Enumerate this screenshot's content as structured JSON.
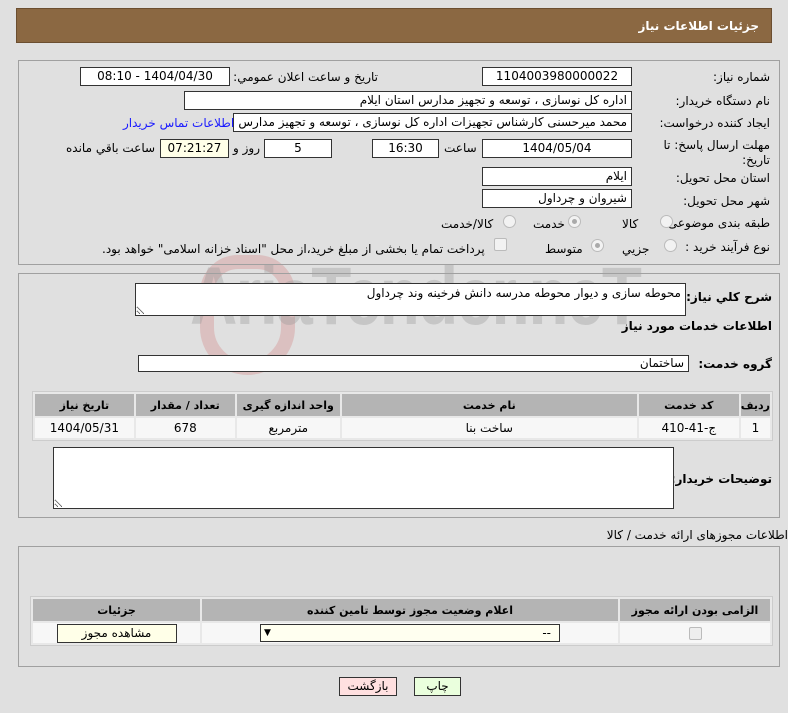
{
  "header": {
    "title": "جزئیات اطلاعات نیاز"
  },
  "details": {
    "need_number_label": "شماره نیاز:",
    "need_number": "1104003980000022",
    "announce_label": "تاریخ و ساعت اعلان عمومي:",
    "announce_value": "1404/04/30 - 08:10",
    "buyer_org_label": "نام دستگاه خریدار:",
    "buyer_org": "اداره کل نوسازی ، توسعه و تجهیز مدارس استان ایلام",
    "creator_label": "ایجاد کننده درخواست:",
    "creator": "محمد میرحسنی کارشناس تجهیزات اداره کل نوسازی ، توسعه و تجهیز مدارس ا",
    "contact_link": "اطلاعات تماس خریدار",
    "deadline_label": "مهلت ارسال پاسخ: تا تاریخ:",
    "deadline_date": "1404/05/04",
    "time_label": "ساعت",
    "deadline_time": "16:30",
    "days": "5",
    "days_label": "روز و",
    "remaining": "07:21:27",
    "remaining_label": "ساعت باقي مانده",
    "province_label": "استان محل تحویل:",
    "province": "ایلام",
    "city_label": "شهر محل تحویل:",
    "city": "شیروان و چرداول",
    "category_label": "طبقه بندی موضوعی:",
    "category_options": [
      "کالا",
      "خدمت",
      "کالا/خدمت"
    ],
    "category_selected": "خدمت",
    "process_label": "نوع فرآیند خرید :",
    "process_options": [
      "جزیي",
      "متوسط"
    ],
    "process_selected": "متوسط",
    "payment_note": "پرداخت تمام یا بخشی از مبلغ خرید،از محل \"اسناد خزانه اسلامی\" خواهد بود."
  },
  "services": {
    "desc_label": "شرح کلي نياز:",
    "desc": "محوطه سازی و دیوار محوطه مدرسه دانش فرخینه وند چرداول",
    "heading": "اطلاعات خدمات مورد نیاز",
    "group_label": "گروه خدمت:",
    "group": "ساختمان",
    "columns": [
      "ردیف",
      "کد خدمت",
      "نام خدمت",
      "واحد اندازه گیری",
      "تعداد / مقدار",
      "تاریخ نیاز"
    ],
    "rows": [
      [
        "1",
        "ج-41-410",
        "ساخت بنا",
        "مترمربع",
        "678",
        "1404/05/31"
      ]
    ],
    "notes_label": "توضیحات خریدار:",
    "notes": ""
  },
  "permits": {
    "title": "اطلاعات مجوزهای ارائه خدمت / کالا",
    "columns": [
      "الزامی بودن ارائه مجوز",
      "اعلام وضعیت مجوز توسط تامین کننده",
      "جزئیات"
    ],
    "select_value": "--",
    "view_button": "مشاهده مجوز"
  },
  "buttons": {
    "print": "چاپ",
    "back": "بازگشت"
  },
  "watermark": "AriaTender.neT"
}
